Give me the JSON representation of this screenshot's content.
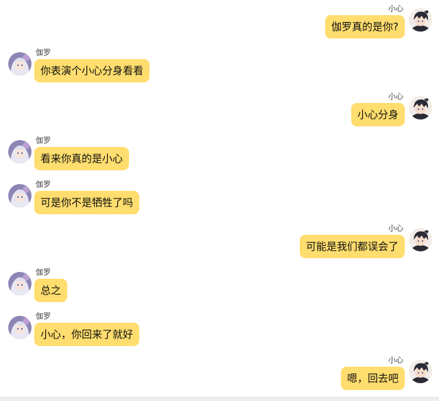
{
  "conversation": {
    "messages": [
      {
        "sender": "小心",
        "text": "伽罗真的是你?"
      },
      {
        "sender": "伽罗",
        "text": "你表演个小心分身看看"
      },
      {
        "sender": "小心",
        "text": "小心分身"
      },
      {
        "sender": "伽罗",
        "text": "看来你真的是小心"
      },
      {
        "sender": "伽罗",
        "text": "可是你不是牺牲了吗"
      },
      {
        "sender": "小心",
        "text": "可能是我们都误会了"
      },
      {
        "sender": "伽罗",
        "text": "总之"
      },
      {
        "sender": "伽罗",
        "text": "小心，你回来了就好"
      },
      {
        "sender": "小心",
        "text": "嗯，回去吧"
      }
    ]
  },
  "colors": {
    "bubble": "#ffdd6e",
    "background": "#ffffff",
    "name_text": "#444444"
  },
  "icons": {
    "left_avatar": "girl-avatar-icon",
    "right_avatar": "boy-avatar-icon"
  }
}
